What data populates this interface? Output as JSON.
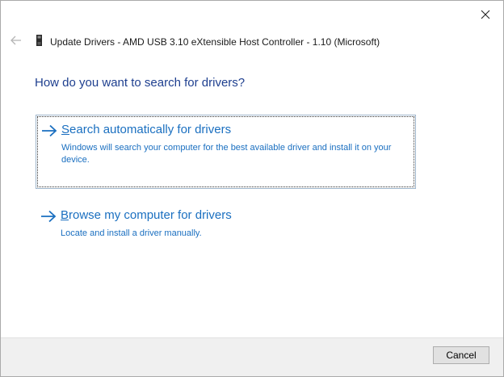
{
  "window": {
    "title": "Update Drivers - AMD USB 3.10 eXtensible Host Controller - 1.10 (Microsoft)"
  },
  "icons": {
    "close": "close-icon",
    "back": "back-arrow-icon",
    "device": "usb-device-icon",
    "option_arrow": "right-arrow-icon"
  },
  "main": {
    "heading": "How do you want to search for drivers?",
    "options": [
      {
        "title_first": "S",
        "title_rest": "earch automatically for drivers",
        "description": "Windows will search your computer for the best available driver and install it on your device."
      },
      {
        "title_first": "B",
        "title_rest": "rowse my computer for drivers",
        "description": "Locate and install a driver manually."
      }
    ]
  },
  "footer": {
    "cancel_label": "Cancel"
  },
  "colors": {
    "link": "#1a6fc0",
    "heading": "#1e3f8f",
    "footer_bg": "#f0f0f0"
  }
}
